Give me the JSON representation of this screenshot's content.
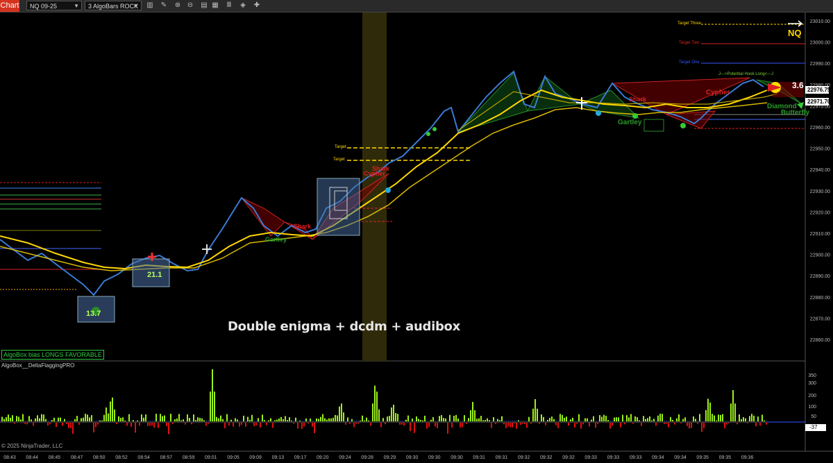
{
  "toolbar": {
    "chart_label": "Chart",
    "instrument": "NQ 09-25",
    "bar_type": "3 AlgoBars ROCK"
  },
  "chart": {
    "symbol_badge": "NQ",
    "watermark": "Double enigma + dcdm + audibox",
    "bias_label": "AlgoBox bias LONGS FAVORABLE",
    "indicator_name": "AlgoBox__DeltaFlaggingPRO",
    "copyright": "© 2025 NinjaTrader, LLC",
    "price_axis": [
      "23010.00",
      "23000.00",
      "22990.00",
      "22980.00",
      "22970.00",
      "22960.00",
      "22950.00",
      "22940.00",
      "22930.00",
      "22920.00",
      "22910.00",
      "22900.00",
      "22890.00",
      "22880.00",
      "22870.00",
      "22860.00"
    ],
    "price_markers": {
      "upper": "22976.75",
      "lower": "22971.70"
    },
    "indicator_axis": [
      "350",
      "300",
      "200",
      "100",
      "50",
      "-37"
    ],
    "time_axis": [
      "08:43",
      "08:44",
      "08:45",
      "08:47",
      "08:50",
      "08:52",
      "08:54",
      "08:57",
      "08:59",
      "09:01",
      "09:05",
      "09:09",
      "09:13",
      "09:17",
      "09:20",
      "09:24",
      "09:28",
      "09:29",
      "09:30",
      "09:30",
      "09:30",
      "09:31",
      "09:31",
      "09:32",
      "09:32",
      "09:32",
      "09:33",
      "09:33",
      "09:33",
      "09:34",
      "09:34",
      "09:35",
      "09:35",
      "09:36"
    ],
    "box_labels": [
      "13.7",
      "21.1",
      "3.6"
    ],
    "pattern_labels": [
      "Gartley",
      "Shark",
      "Shark",
      "Cypher",
      "Shark",
      "Gartley",
      "Cypher",
      "Diamond",
      "Butterfly"
    ],
    "target_labels": [
      "Target Three",
      "Target Two",
      "Target One",
      "Target",
      "Target"
    ],
    "potential_label": "J--->Potential Hook Long<---J"
  }
}
